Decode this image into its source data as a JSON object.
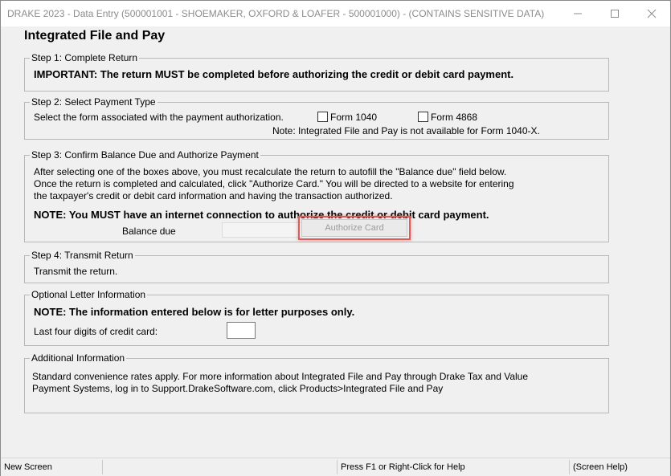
{
  "window": {
    "title": "DRAKE 2023 - Data Entry (500001001 - SHOEMAKER, OXFORD & LOAFER - 500001000) - (CONTAINS SENSITIVE DATA)"
  },
  "page": {
    "title": "Integrated File and Pay"
  },
  "step1": {
    "legend": "Step 1: Complete Return",
    "important": "IMPORTANT: The return MUST be completed before authorizing the credit or debit card payment."
  },
  "step2": {
    "legend": "Step 2: Select Payment Type",
    "instruction": "Select the form associated with the payment authorization.",
    "options": [
      {
        "label": "Form 1040",
        "checked": false
      },
      {
        "label": "Form 4868",
        "checked": false
      }
    ],
    "note": "Note: Integrated File and Pay is not available for Form 1040-X."
  },
  "step3": {
    "legend": "Step 3: Confirm Balance Due and Authorize Payment",
    "lines": [
      "After selecting one of the boxes above, you must recalculate the return to autofill the \"Balance due\" field below.",
      "Once the return is completed and calculated, click \"Authorize Card.\"  You will be directed to a website for entering",
      "the taxpayer's credit or debit card information and having the transaction authorized."
    ],
    "note": "NOTE: You MUST have an internet connection to authorize the credit or debit card payment.",
    "balance_label": "Balance due",
    "balance_value": "",
    "authorize_button": "Authorize Card"
  },
  "step4": {
    "legend": "Step 4: Transmit Return",
    "text": "Transmit the return."
  },
  "letter": {
    "legend": "Optional Letter Information",
    "note": "NOTE: The information entered below is for letter purposes only.",
    "card_label": "Last four digits of credit card:",
    "card_value": ""
  },
  "additional": {
    "legend": "Additional Information",
    "lines": [
      "Standard convenience rates apply.  For more information about Integrated File and Pay through Drake Tax and Value",
      "Payment Systems, log in to Support.DrakeSoftware.com, click Products>Integrated File and Pay"
    ]
  },
  "statusbar": {
    "left": "New Screen",
    "middle": "Press F1 or Right-Click for Help",
    "right": "(Screen Help)"
  },
  "colors": {
    "highlight": "#e05a5a",
    "window_bg": "#f0f0f0"
  }
}
